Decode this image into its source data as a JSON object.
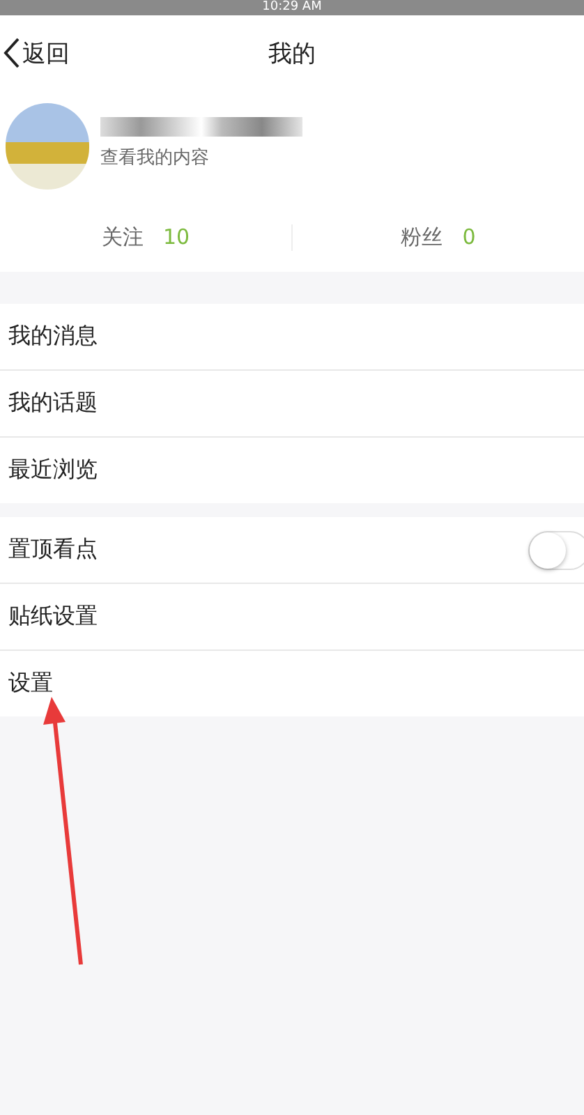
{
  "status_bar": {
    "time": "10:29 AM"
  },
  "header": {
    "back_label": "返回",
    "title": "我的"
  },
  "profile": {
    "subtitle": "查看我的内容"
  },
  "stats": [
    {
      "label": "关注",
      "value": "10"
    },
    {
      "label": "粉丝",
      "value": "0"
    }
  ],
  "sections": [
    {
      "items": [
        {
          "kind": "link",
          "label": "我的消息"
        },
        {
          "kind": "link",
          "label": "我的话题"
        },
        {
          "kind": "link",
          "label": "最近浏览"
        }
      ]
    },
    {
      "items": [
        {
          "kind": "toggle",
          "label": "置顶看点",
          "on": false
        },
        {
          "kind": "link",
          "label": "贴纸设置"
        },
        {
          "kind": "link",
          "label": "设置"
        }
      ]
    }
  ]
}
